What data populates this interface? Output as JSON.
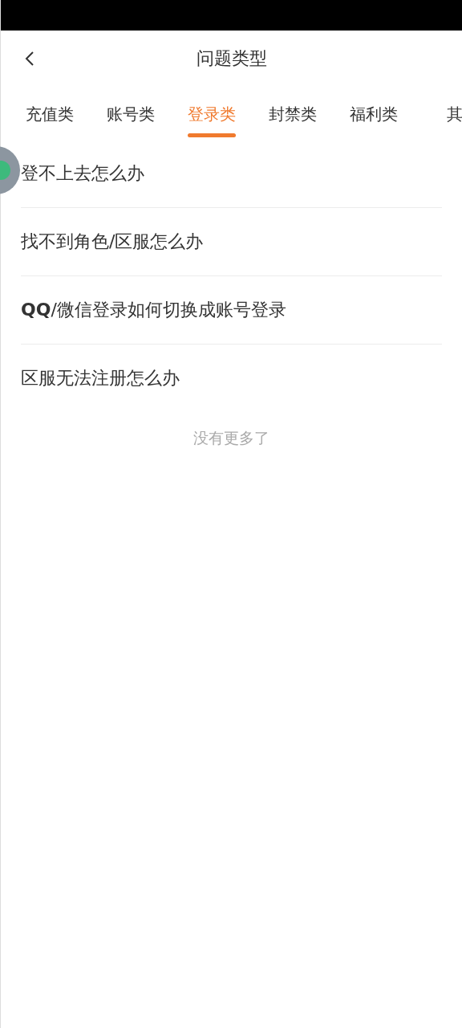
{
  "header": {
    "title": "问题类型"
  },
  "tabs": [
    {
      "label": "充值类",
      "selected": false
    },
    {
      "label": "账号类",
      "selected": false
    },
    {
      "label": "登录类",
      "selected": true
    },
    {
      "label": "封禁类",
      "selected": false
    },
    {
      "label": "福利类",
      "selected": false
    },
    {
      "label": "其",
      "selected": false
    }
  ],
  "questions": [
    "登不上去怎么办",
    "找不到角色/区服怎么办",
    "**QQ**/微信登录如何切换成账号登录",
    "区服无法注册怎么办"
  ],
  "footer": "没有更多了"
}
